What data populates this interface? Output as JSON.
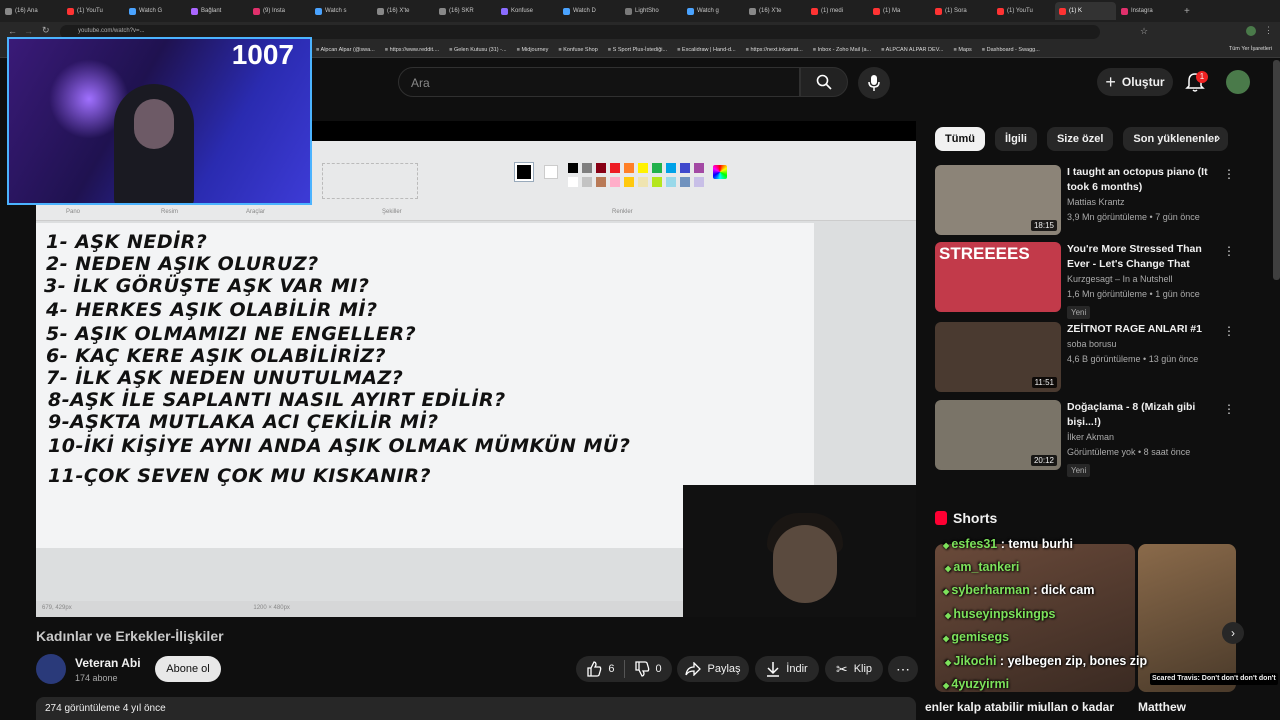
{
  "browser": {
    "tabs": [
      {
        "label": "(16) Ana",
        "color": "#888888"
      },
      {
        "label": "(1) YouTu",
        "color": "#ff3333"
      },
      {
        "label": "Watch G",
        "color": "#4aa3ff"
      },
      {
        "label": "Bağlant",
        "color": "#aa66ff"
      },
      {
        "label": "(9) Insta",
        "color": "#e1306c"
      },
      {
        "label": "Watch s",
        "color": "#4aa3ff"
      },
      {
        "label": "(16) X'te",
        "color": "#888888"
      },
      {
        "label": "(16) SKR",
        "color": "#888888"
      },
      {
        "label": "Konfuse",
        "color": "#8a6cff"
      },
      {
        "label": "Watch D",
        "color": "#4aa3ff"
      },
      {
        "label": "LightSho",
        "color": "#7a7a7a"
      },
      {
        "label": "Watch g",
        "color": "#4aa3ff"
      },
      {
        "label": "(16) X'te",
        "color": "#888888"
      },
      {
        "label": "(1) medi",
        "color": "#ff3333"
      },
      {
        "label": "(1) Ma",
        "color": "#ff3333"
      },
      {
        "label": "(1) Sora",
        "color": "#ff3333"
      },
      {
        "label": "(1) YouTu",
        "color": "#ff3333"
      },
      {
        "label": "(1) K",
        "color": "#ff3333"
      },
      {
        "label": "Instagra",
        "color": "#e1306c"
      }
    ],
    "active_tab_index": 17,
    "address": "youtube.com/watch?v=...",
    "bookmarks": [
      "Alpcan Alpar (@swa...",
      "https://www.reddit....",
      "Gelen Kutusu (31) -...",
      "Midjourney",
      "Konfuse Shop",
      "S Sport Plus-İstediği...",
      "Excalidraw | Hand-d...",
      "https://next.inkamat...",
      "Inbox - Zoho Mail (a...",
      "ALPCAN ALPAR DEV...",
      "Maps",
      "Dashboard - Swagg..."
    ],
    "bookmarks_right": "Tüm Yer İşaretleri"
  },
  "stream": {
    "counter": "1007"
  },
  "header": {
    "search_placeholder": "Ara",
    "create_label": "Oluştur",
    "notification_count": "1"
  },
  "paint": {
    "ribbon_labels": [
      "Pano",
      "Resim",
      "Araçlar",
      "Şekiller",
      "Renkler"
    ],
    "colors": [
      "#000000",
      "#7f7f7f",
      "#880015",
      "#ed1c24",
      "#ff7f27",
      "#fff200",
      "#22b14c",
      "#00a2e8",
      "#3f48cc",
      "#a349a4",
      "#ffffff",
      "#c3c3c3",
      "#b97a57",
      "#ffaec9",
      "#ffc90e",
      "#efe4b0",
      "#b5e61d",
      "#99d9ea",
      "#7092be",
      "#c8bfe7"
    ],
    "lines": [
      "1- AŞK NEDİR?",
      "2- NEDEN AŞIK OLURUZ?",
      "3- İLK GÖRÜŞTE AŞK VAR MI?",
      "4- HERKES AŞIK OLABİLİR Mİ?",
      "5- AŞIK OLMAMIZI NE ENGELLER?",
      "6- KAÇ KERE AŞIK OLABİLİRİZ?",
      "7- İLK AŞK NEDEN UNUTULMAZ?",
      "8-AŞK İLE SAPLANTI NASIL AYIRT EDİLİR?",
      "9-AŞKTA MUTLAKA ACI ÇEKİLİR Mİ?",
      "10-İKİ KİŞİYE AYNI ANDA AŞIK OLMAK MÜMKÜN MÜ?",
      "11-ÇOK SEVEN ÇOK MU KISKANIR?"
    ],
    "status_pos": "679, 429px",
    "status_size": "1200 × 480px"
  },
  "video": {
    "title": "Kadınlar ve Erkekler-İlişkiler",
    "channel": "Veteran Abi",
    "subscribers": "174 abone",
    "subscribe_label": "Abone ol",
    "likes": "6",
    "dislikes": "0",
    "share_label": "Paylaş",
    "download_label": "İndir",
    "clip_label": "Klip",
    "views_line": "274 görüntüleme  4 yıl önce"
  },
  "chips": [
    "Tümü",
    "İlgili",
    "Size özel",
    "Son yüklenenler"
  ],
  "recommendations": [
    {
      "title": "I taught an octopus piano (It took 6 months)",
      "channel": "Mattias Krantz",
      "meta": "3,9 Mn görüntüleme • 7 gün önce",
      "duration": "18:15",
      "new": "",
      "thumb_color": "#8c8478"
    },
    {
      "title": "You're More Stressed Than Ever - Let's Change That",
      "channel": "Kurzgesagt – In a Nutshell",
      "meta": "1,6 Mn görüntüleme • 1 gün önce",
      "duration": "",
      "new": "Yeni",
      "thumb_color": "#c23a4a"
    },
    {
      "title": "ZEİTNOT RAGE ANLARI #1",
      "channel": "soba borusu",
      "meta": "4,6 B görüntüleme • 13 gün önce",
      "duration": "11:51",
      "new": "",
      "thumb_color": "#4a3a30"
    },
    {
      "title": "Doğaçlama - 8 (Mizah gibi bişi...!)",
      "channel": "İlker Akman",
      "meta": "Görüntüleme yok • 8 saat önce",
      "duration": "20:12",
      "new": "Yeni",
      "thumb_color": "#7a7468"
    }
  ],
  "rec_overlay_text": "STREEEES",
  "shorts": {
    "title": "Shorts",
    "caption": "Scared Travis: Don't don't don't don't",
    "bottom_titles": [
      "enler kalp atabilir mi",
      "ullan o kadar",
      "Matthew"
    ]
  },
  "chat": [
    {
      "user": "esfes31",
      "msg": "temu burhi"
    },
    {
      "user": "am_tankeri",
      "msg": ""
    },
    {
      "user": "syberharman",
      "msg": "dick cam"
    },
    {
      "user": "huseyinpskingps",
      "msg": ""
    },
    {
      "user": "gemisegs",
      "msg": ""
    },
    {
      "user": "Jikochi",
      "msg": "yelbegen zip, bones zip"
    },
    {
      "user": "4yuzyirmi",
      "msg": ""
    }
  ]
}
